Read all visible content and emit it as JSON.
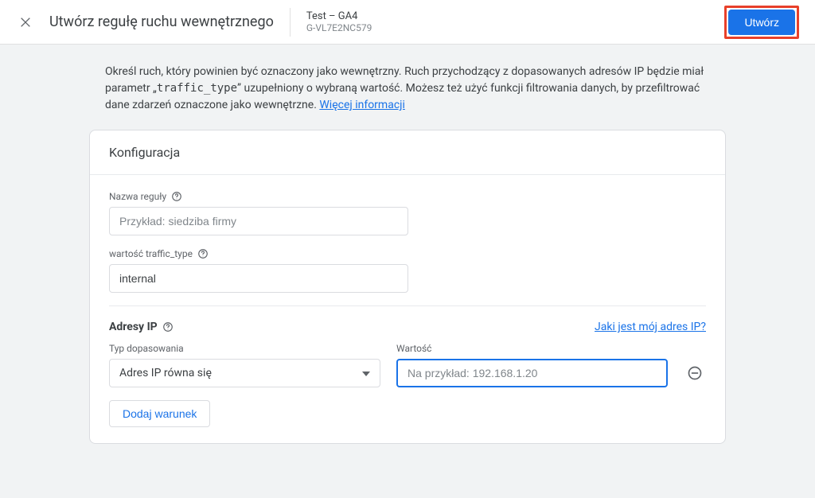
{
  "header": {
    "title": "Utwórz regułę ruchu wewnętrznego",
    "property_name": "Test – GA4",
    "property_id": "G-VL7E2NC579",
    "create_button": "Utwórz"
  },
  "intro": {
    "part1": "Określ ruch, który powinien być oznaczony jako wewnętrzny. Ruch przychodzący z dopasowanych adresów IP będzie miał parametr „",
    "code": "traffic_type",
    "part2": "” uzupełniony o wybraną wartość. Możesz też użyć funkcji filtrowania danych, by przefiltrować dane zdarzeń oznaczone jako wewnętrzne. ",
    "link": "Więcej informacji"
  },
  "config": {
    "card_title": "Konfiguracja",
    "rule_name_label": "Nazwa reguły",
    "rule_name_placeholder": "Przykład: siedziba firmy",
    "rule_name_value": "",
    "traffic_type_label": "wartość traffic_type",
    "traffic_type_value": "internal",
    "ip_section_title": "Adresy IP",
    "ip_section_link": "Jaki jest mój adres IP?",
    "match_type_label": "Typ dopasowania",
    "match_type_value": "Adres IP równa się",
    "value_label": "Wartość",
    "value_placeholder": "Na przykład: 192.168.1.20",
    "value_value": "",
    "add_condition": "Dodaj warunek"
  }
}
